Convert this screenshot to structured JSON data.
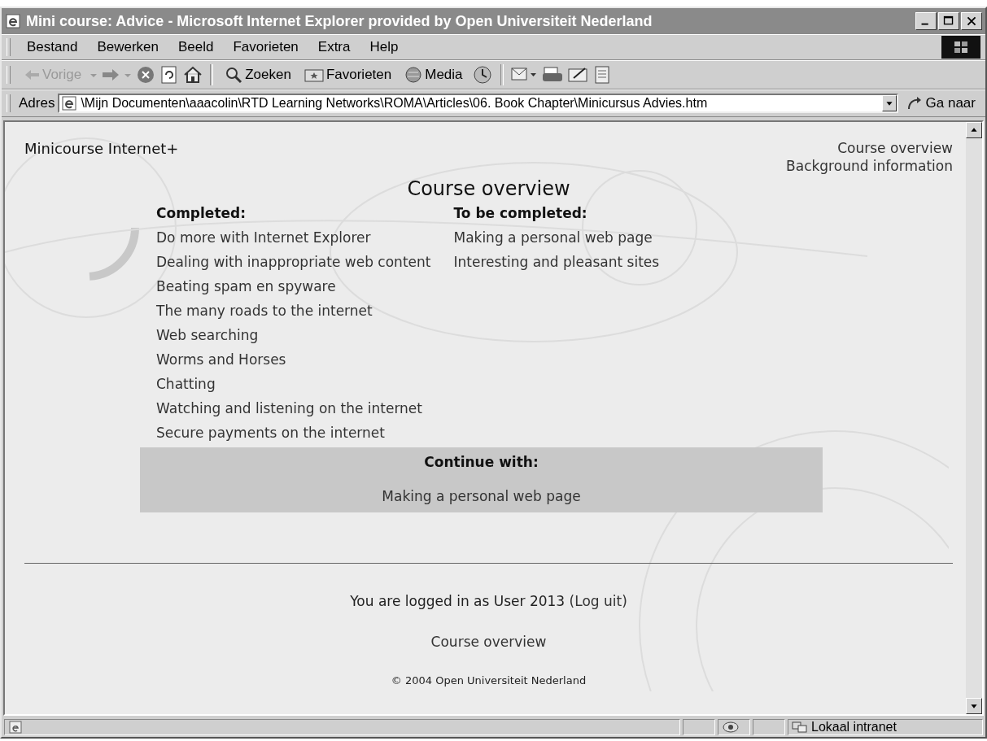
{
  "window": {
    "title": "Mini course: Advice - Microsoft Internet Explorer provided by Open Universiteit Nederland"
  },
  "menu": [
    "Bestand",
    "Bewerken",
    "Beeld",
    "Favorieten",
    "Extra",
    "Help"
  ],
  "toolbar": {
    "back": {
      "label": "Vorige",
      "disabled": true
    },
    "search": "Zoeken",
    "favorites": "Favorieten",
    "media": "Media"
  },
  "address": {
    "label": "Adres",
    "value": "\\Mijn Documenten\\aaacolin\\RTD Learning Networks\\ROMA\\Articles\\06. Book Chapter\\Minicursus Advies.htm",
    "go": "Ga naar"
  },
  "page": {
    "site_title": "Minicourse Internet+",
    "nav_links": [
      "Course overview",
      "Background information"
    ],
    "heading": "Course overview",
    "completed": {
      "title": "Completed:",
      "items": [
        "Do more with Internet Explorer",
        "Dealing with inappropriate web content",
        "Beating spam en spyware",
        "The many roads to the internet",
        "Web searching",
        "Worms and Horses",
        "Chatting",
        "Watching and listening on the internet",
        "Secure payments on the internet"
      ]
    },
    "to_be_completed": {
      "title": "To be completed:",
      "items": [
        "Making a personal web page",
        "Interesting and pleasant sites"
      ]
    },
    "continue": {
      "title": "Continue with:",
      "link": "Making a personal web page"
    },
    "login": {
      "text": "You are logged in as User 2013",
      "link": "(Log uit)"
    },
    "footer_link": "Course overview",
    "copyright": "© 2004 Open Universiteit Nederland"
  },
  "status_bar": {
    "zone": "Lokaal intranet"
  }
}
